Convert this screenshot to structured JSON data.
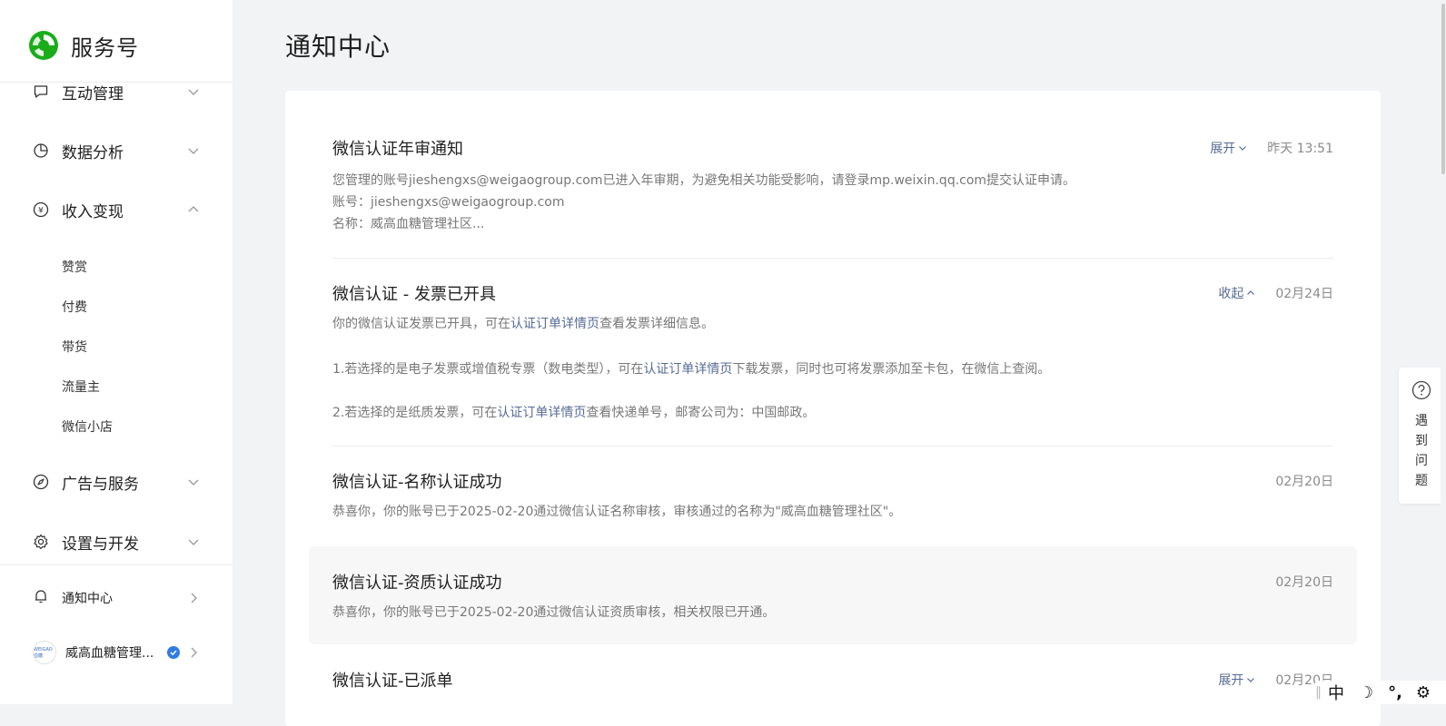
{
  "brand": {
    "name": "服务号"
  },
  "sidebar": {
    "items": [
      {
        "label": "互动管理",
        "icon": "chat-icon"
      },
      {
        "label": "数据分析",
        "icon": "pie-chart-icon"
      },
      {
        "label": "收入变现",
        "icon": "yen-icon"
      }
    ],
    "sub_items": [
      "赞赏",
      "付费",
      "带货",
      "流量主",
      "微信小店"
    ],
    "items_after": [
      {
        "label": "广告与服务",
        "icon": "compass-icon"
      },
      {
        "label": "设置与开发",
        "icon": "gear-icon"
      }
    ],
    "notification_label": "通知中心",
    "account": {
      "name": "威高血糖管理...",
      "avatar_text": "WEIGAO血糖"
    }
  },
  "main": {
    "title": "通知中心",
    "notices": [
      {
        "title": "微信认证年审通知",
        "toggle": "展开",
        "time": "昨天 13:51",
        "lines": [
          "您管理的账号jieshengxs@weigaogroup.com已进入年审期，为避免相关功能受影响，请登录mp.weixin.qq.com提交认证申请。",
          "账号：jieshengxs@weigaogroup.com",
          "名称：威高血糖管理社区..."
        ]
      },
      {
        "title": "微信认证 - 发票已开具",
        "toggle": "收起",
        "time": "02月24日",
        "line1": {
          "a": "你的微信认证发票已开具，可在",
          "link": "认证订单详情页",
          "b": "查看发票详细信息。"
        },
        "line2": {
          "a": "1.若选择的是电子发票或增值税专票（数电类型），可在",
          "link": "认证订单详情页",
          "b": "下载发票，同时也可将发票添加至卡包，在微信上查阅。"
        },
        "line3": {
          "a": "2.若选择的是纸质发票，可在",
          "link": "认证订单详情页",
          "b": "查看快递单号，邮寄公司为：中国邮政。"
        }
      },
      {
        "title": "微信认证-名称认证成功",
        "time": "02月20日",
        "line": "恭喜你，你的账号已于2025-02-20通过微信认证名称审核，审核通过的名称为\"威高血糖管理社区\"。"
      },
      {
        "title": "微信认证-资质认证成功",
        "time": "02月20日",
        "line": "恭喜你，你的账号已于2025-02-20通过微信认证资质审核，相关权限已开通。"
      },
      {
        "title": "微信认证-已派单",
        "toggle": "展开",
        "time": "02月20日"
      }
    ]
  },
  "help": {
    "text": "遇\n到\n问\n题"
  },
  "ime": {
    "lang": "中",
    "moon": "☽",
    "punct": "°,",
    "settings": "⚙"
  },
  "colors": {
    "link": "#576b95",
    "brand_green": "#1aad19",
    "verified": "#2f7de1"
  }
}
